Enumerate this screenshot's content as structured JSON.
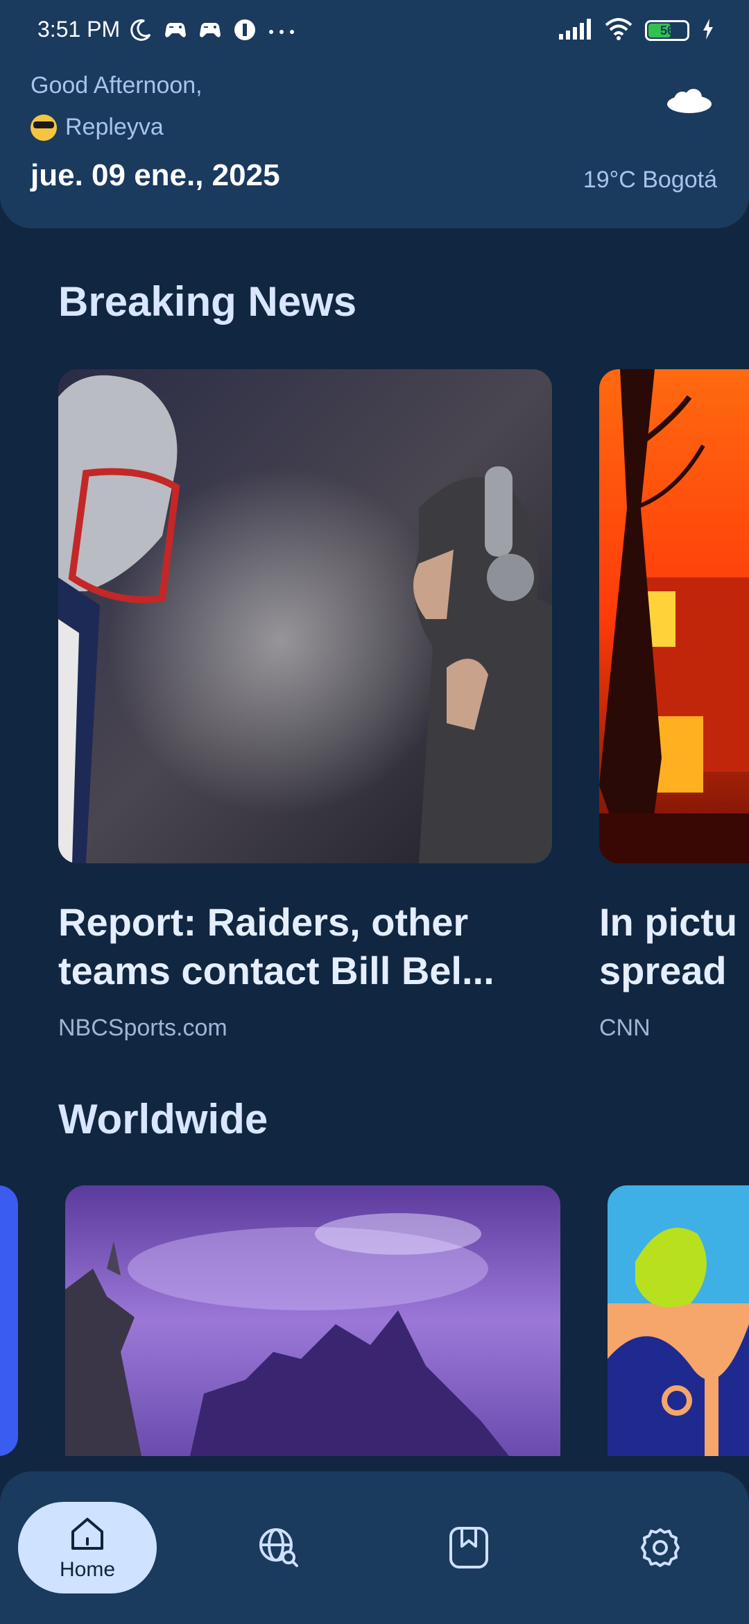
{
  "status_bar": {
    "time": "3:51 PM",
    "battery": "56",
    "icons_left": [
      "moon-icon",
      "game-controller-icon",
      "game-controller-icon",
      "app-icon",
      "more-dots-icon"
    ],
    "icons_right": [
      "signal-icon",
      "wifi-icon",
      "battery-icon",
      "charging-icon"
    ]
  },
  "header": {
    "greeting": "Good Afternoon,",
    "username": "Repleyva",
    "date": "jue. 09 ene., 2025",
    "weather": "19°C Bogotá",
    "weather_icon": "cloud-icon"
  },
  "sections": {
    "breaking": {
      "title": "Breaking News",
      "cards": [
        {
          "title": "Report: Raiders, other teams contact Bill Bel...",
          "source": "NBCSports.com"
        },
        {
          "title": "In pictu spread",
          "title_line1": "In pictu",
          "title_line2": "spread",
          "source": "CNN"
        }
      ]
    },
    "worldwide": {
      "title": "Worldwide"
    }
  },
  "nav": {
    "items": [
      {
        "label": "Home",
        "icon": "home-icon",
        "active": true
      },
      {
        "label": "",
        "icon": "globe-search-icon",
        "active": false
      },
      {
        "label": "",
        "icon": "bookmark-icon",
        "active": false
      },
      {
        "label": "",
        "icon": "settings-icon",
        "active": false
      }
    ]
  },
  "colors": {
    "background": "#112640",
    "header_bg": "#1a3a5e",
    "nav_active_bg": "#cfe2ff",
    "text_primary": "#e5eeff",
    "text_secondary": "#9fb6d8"
  }
}
